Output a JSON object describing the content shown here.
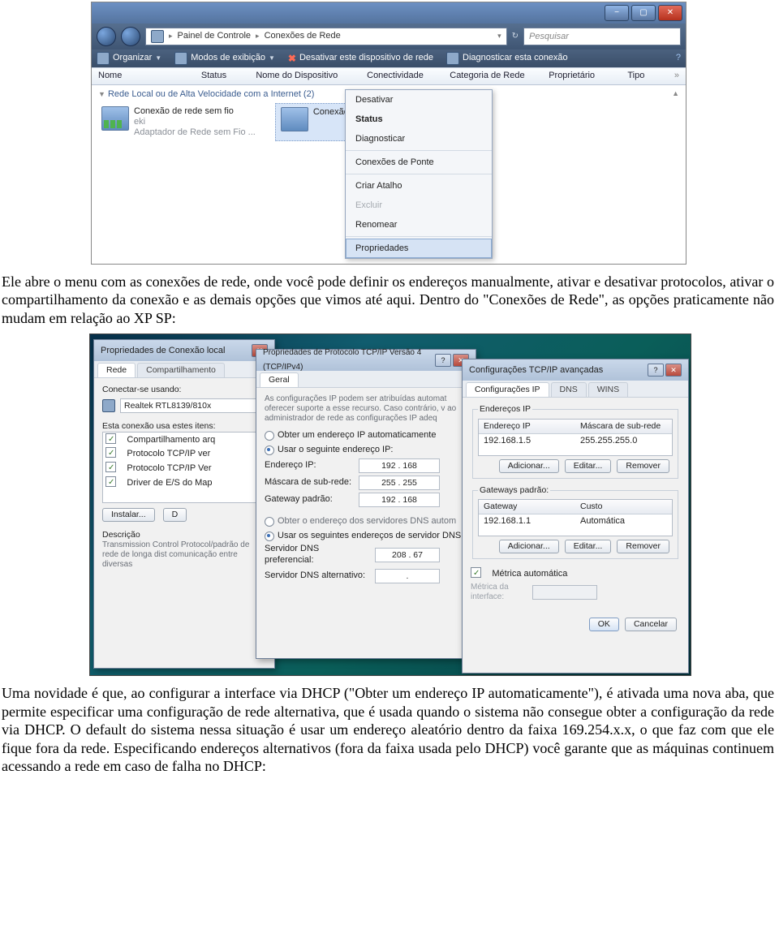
{
  "paragraphs": {
    "p1": "Ele abre o menu com as conexões de rede, onde você pode definir os endereços manualmente, ativar e desativar protocolos, ativar o compartilhamento da conexão e as demais opções que vimos até aqui. Dentro do \"Conexões de Rede\", as opções praticamente não mudam em relação ao XP SP:",
    "p2": "Uma novidade é que, ao configurar a interface via DHCP (\"Obter um endereço IP automaticamente\"), é ativada uma nova aba, que permite especificar uma configuração de rede alternativa, que é usada quando o sistema não consegue obter a configuração da rede via DHCP. O default do sistema nessa situação é usar um endereço aleatório dentro da faixa 169.254.x.x, o que faz com que ele fique fora da rede. Especificando endereços alternativos (fora da faixa usada pelo DHCP) você garante que as máquinas continuem acessando a rede em caso de falha no DHCP:"
  },
  "shot1": {
    "breadcrumb": {
      "a": "Painel de Controle",
      "b": "Conexões de Rede"
    },
    "search_placeholder": "Pesquisar",
    "toolbar": {
      "organize": "Organizar",
      "views": "Modos de exibição",
      "disable": "Desativar este dispositivo de rede",
      "diagnose": "Diagnosticar esta conexão"
    },
    "cols": [
      "Nome",
      "Status",
      "Nome do Dispositivo",
      "Conectividade",
      "Categoria de Rede",
      "Proprietário",
      "Tipo"
    ],
    "category": "Rede Local ou de Alta Velocidade com a Internet (2)",
    "connA": {
      "name": "Conexão de rede sem fio",
      "ssid": "eki",
      "adapter": "Adaptador de Rede sem Fio ..."
    },
    "connB": {
      "name": "Conexão local"
    },
    "ctx": {
      "deactivate": "Desativar",
      "status": "Status",
      "diag": "Diagnosticar",
      "bridge": "Conexões de Ponte",
      "shortcut": "Criar Atalho",
      "delete": "Excluir",
      "rename": "Renomear",
      "properties": "Propriedades"
    }
  },
  "shot2": {
    "d1": {
      "title": "Propriedades de Conexão local",
      "tabs": [
        "Rede",
        "Compartilhamento"
      ],
      "connect_lbl": "Conectar-se usando:",
      "adapter": "Realtek RTL8139/810x",
      "items_lbl": "Esta conexão usa estes itens:",
      "items": [
        "Compartilhamento arq",
        "Protocolo TCP/IP ver",
        "Protocolo TCP/IP Ver",
        "Driver de E/S do Map"
      ],
      "install": "Instalar...",
      "d": "D",
      "desc_lbl": "Descrição",
      "desc": "Transmission Control Protocol/padrão de rede de longa dist comunicação entre diversas"
    },
    "d2": {
      "title": "Propriedades de Protocolo TCP/IP Versão 4 (TCP/IPv4)",
      "tab": "Geral",
      "intro": "As configurações IP podem ser atribuídas automat oferecer suporte a esse recurso. Caso contrário, v ao administrador de rede as configurações IP adeq",
      "r_auto": "Obter um endereço IP automaticamente",
      "r_manual": "Usar o seguinte endereço IP:",
      "ip_lbl": "Endereço IP:",
      "ip": "192 . 168",
      "mask_lbl": "Máscara de sub-rede:",
      "mask": "255 . 255",
      "gw_lbl": "Gateway padrão:",
      "gw": "192 . 168",
      "r_dns_auto": "Obter o endereço dos servidores DNS autom",
      "r_dns_man": "Usar os seguintes endereços de servidor DNS",
      "dns1_lbl": "Servidor DNS preferencial:",
      "dns1": "208 . 67",
      "dns2_lbl": "Servidor DNS alternativo:",
      "dns2": "."
    },
    "d3": {
      "title": "Configurações TCP/IP avançadas",
      "tabs": [
        "Configurações IP",
        "DNS",
        "WINS"
      ],
      "ip_hdr": "Endereços IP",
      "col_ip": "Endereço IP",
      "col_mask": "Máscara de sub-rede",
      "ip_val": "192.168.1.5",
      "mask_val": "255.255.255.0",
      "gw_hdr": "Gateways padrão:",
      "col_gw": "Gateway",
      "col_cost": "Custo",
      "gw_val": "192.168.1.1",
      "cost_val": "Automática",
      "add": "Adicionar...",
      "edit": "Editar...",
      "remove": "Remover",
      "auto_metric": "Métrica automática",
      "metric_lbl": "Métrica da interface:",
      "ok": "OK",
      "cancel": "Cancelar"
    }
  }
}
